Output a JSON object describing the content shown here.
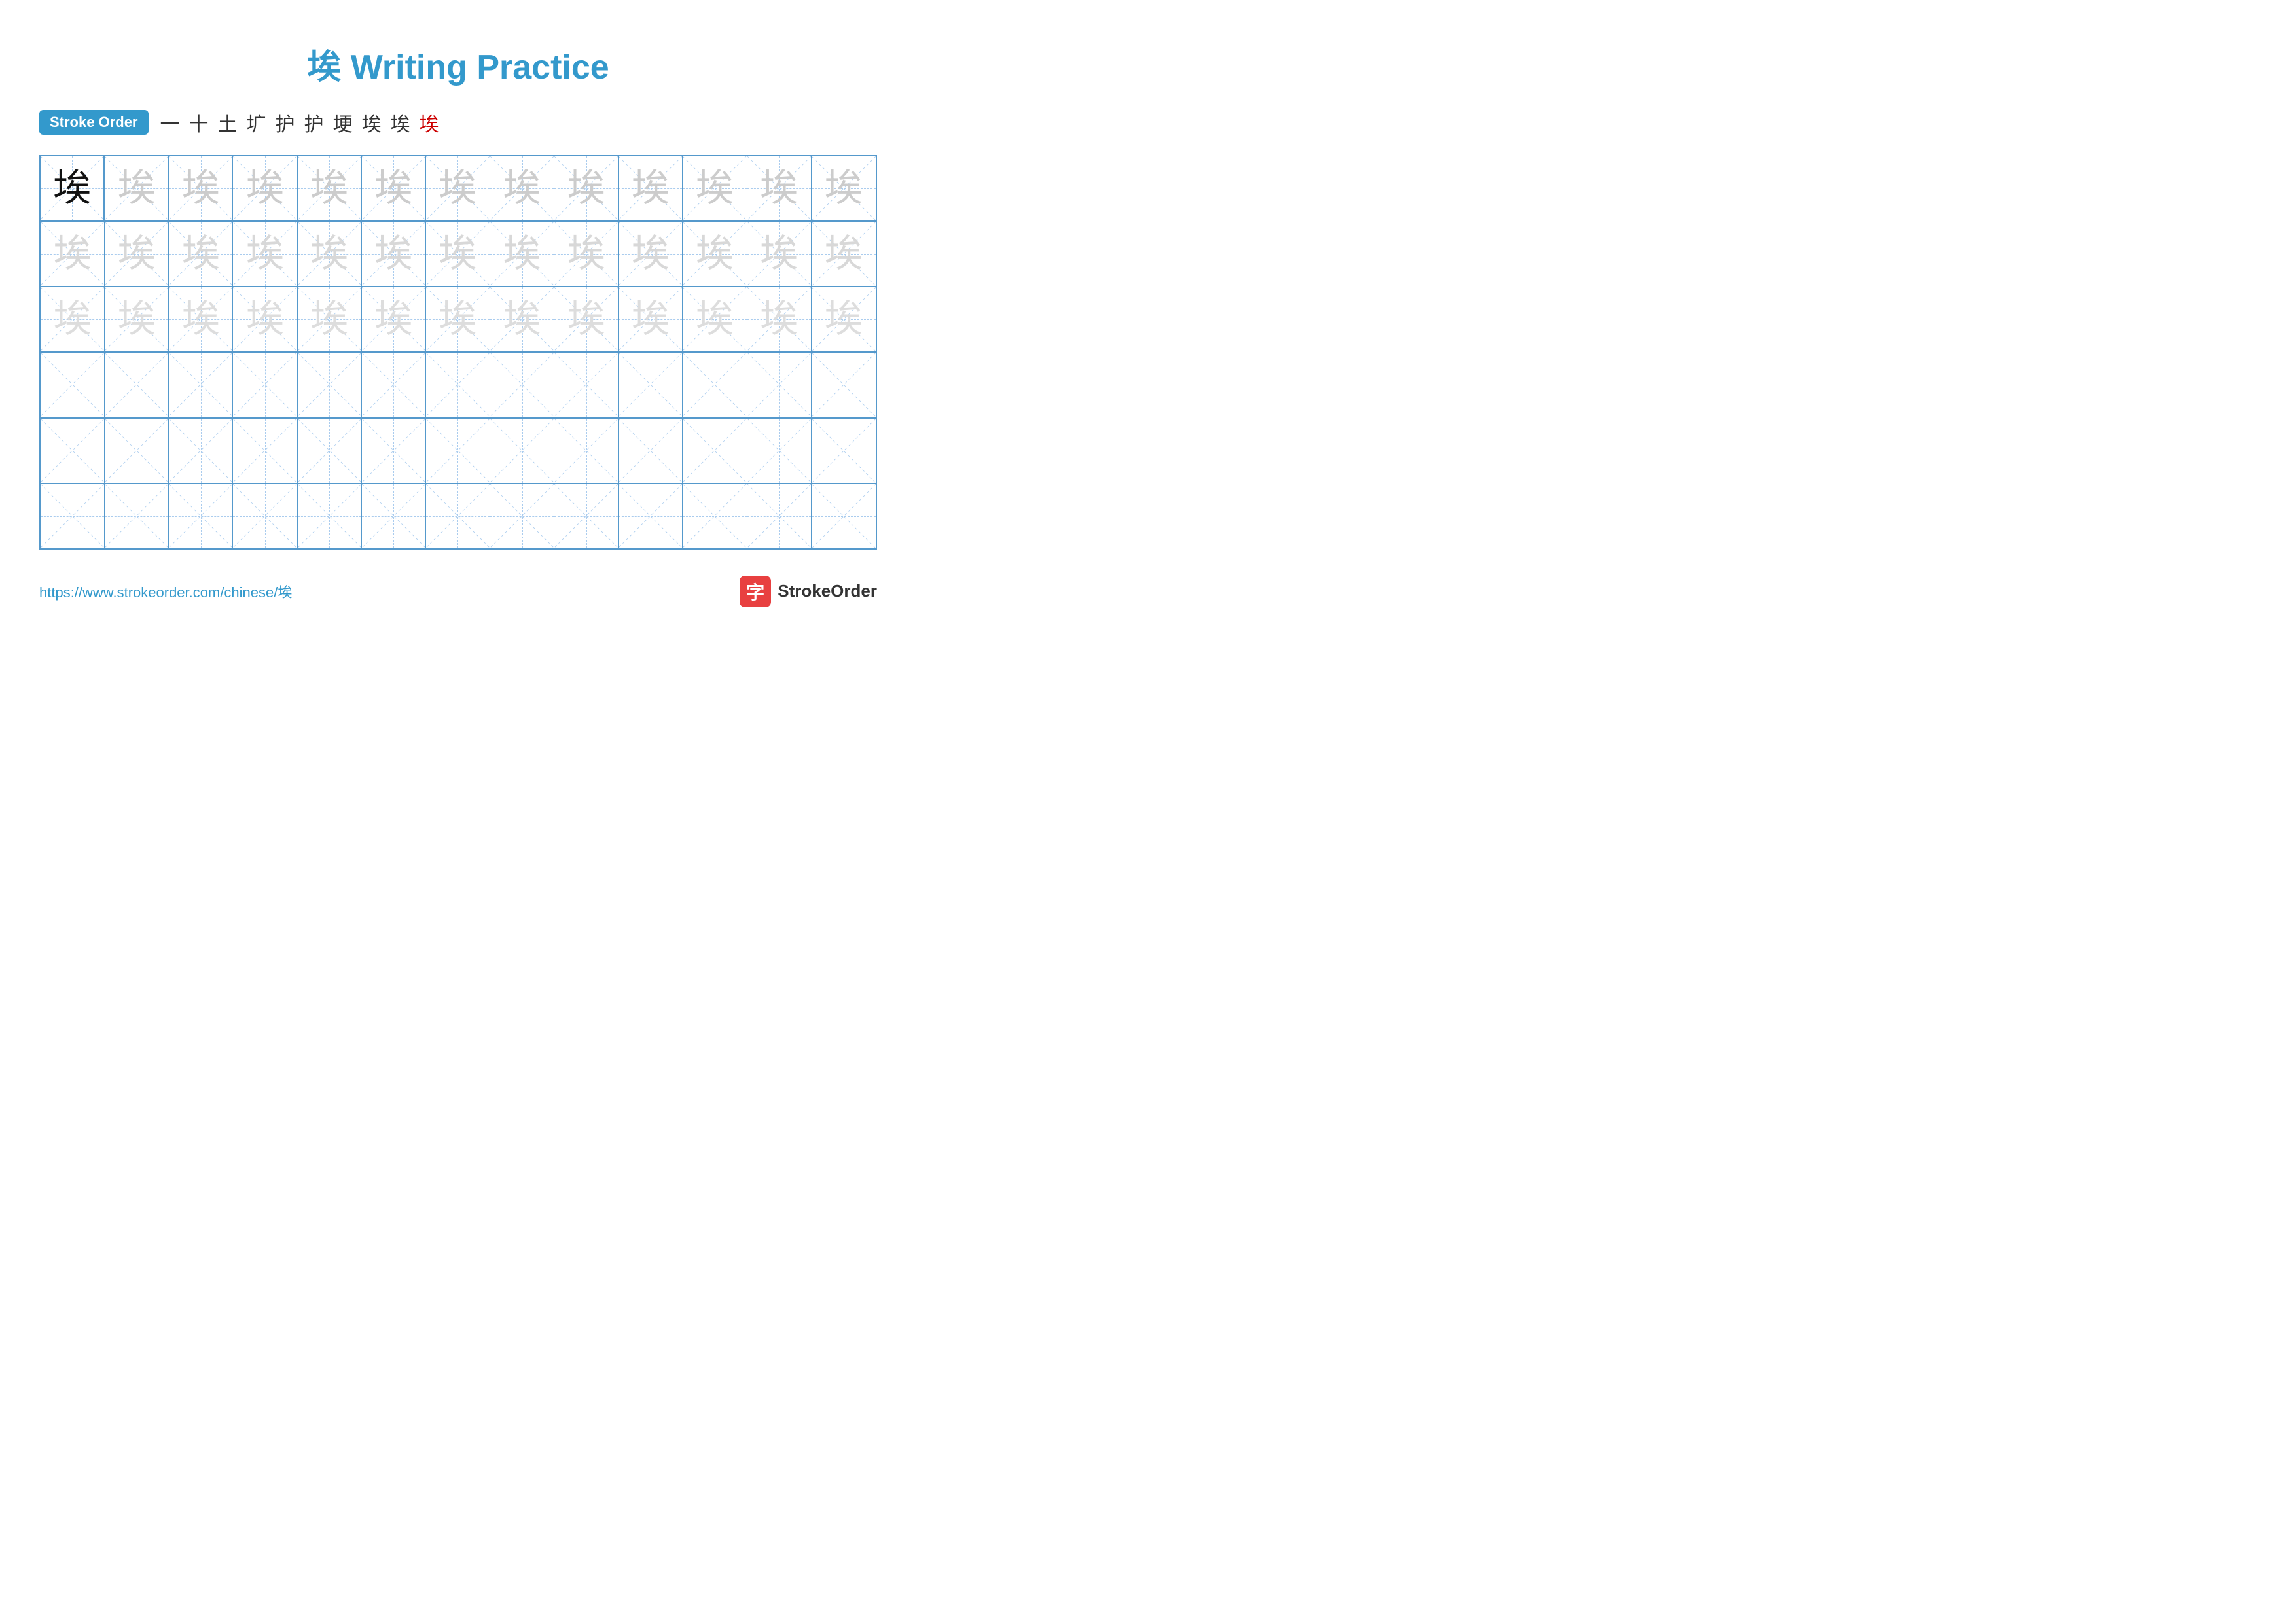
{
  "page": {
    "title": "埃 Writing Practice",
    "url": "https://www.strokeorder.com/chinese/埃",
    "brand": "StrokeOrder",
    "brand_char": "字"
  },
  "stroke_order": {
    "label": "Stroke Order",
    "strokes": [
      {
        "char": "一",
        "red": false
      },
      {
        "char": "十",
        "red": false
      },
      {
        "char": "土",
        "red": false
      },
      {
        "char": "圹",
        "red": false
      },
      {
        "char": "护",
        "red": false
      },
      {
        "char": "护",
        "red": false
      },
      {
        "char": "埂",
        "red": false
      },
      {
        "char": "埃",
        "red": false
      },
      {
        "char": "埃",
        "red": false
      },
      {
        "char": "埃",
        "red": true
      }
    ]
  },
  "grid": {
    "cols": 13,
    "rows": 6,
    "main_char": "埃",
    "row_types": [
      "dark",
      "light",
      "lighter",
      "empty",
      "empty",
      "empty"
    ]
  }
}
